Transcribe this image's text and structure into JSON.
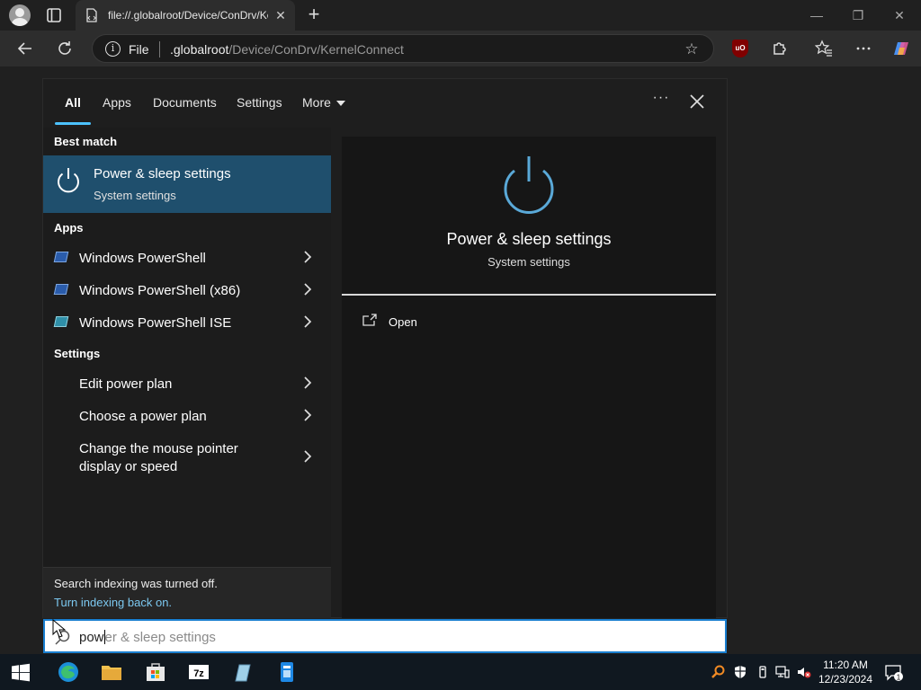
{
  "browser": {
    "tab_title": "file://.globalroot/Device/ConDrv/KernelConnect",
    "tab_close": "✕",
    "new_tab": "+",
    "win_minimize": "—",
    "win_restore": "❐",
    "win_close": "✕",
    "address": {
      "scheme_label": "File",
      "host": ".globalroot",
      "path": "/Device/ConDrv/KernelConnect"
    },
    "extension_label": "uO"
  },
  "search": {
    "tabs": [
      {
        "label": "All"
      },
      {
        "label": "Apps"
      },
      {
        "label": "Documents"
      },
      {
        "label": "Settings"
      },
      {
        "label": "More"
      }
    ],
    "more_dots": "···",
    "best_match": {
      "heading": "Best match",
      "title": "Power & sleep settings",
      "subtitle": "System settings"
    },
    "apps": {
      "heading": "Apps",
      "items": [
        {
          "label": "Windows PowerShell"
        },
        {
          "label": "Windows PowerShell (x86)"
        },
        {
          "label": "Windows PowerShell ISE"
        }
      ]
    },
    "settings": {
      "heading": "Settings",
      "items": [
        {
          "label": "Edit power plan"
        },
        {
          "label": "Choose a power plan"
        },
        {
          "label_line1": "Change the mouse pointer",
          "label_line2": "display or speed"
        }
      ]
    },
    "indexing": {
      "message": "Search indexing was turned off.",
      "link": "Turn indexing back on."
    },
    "preview": {
      "title": "Power & sleep settings",
      "subtitle": "System settings",
      "open_label": "Open"
    },
    "query": {
      "typed": "pow",
      "suggestion": "er & sleep settings"
    }
  },
  "taskbar": {
    "time": "11:20 AM",
    "date": "12/23/2024",
    "notification_count": "1",
    "apps": [
      "start-icon",
      "edge-icon",
      "file-explorer-icon",
      "store-icon",
      "7zip-icon",
      "notepad-icon",
      "app-icon"
    ]
  },
  "colors": {
    "accent": "#4cc2ff",
    "best_match_bg": "#1f4f6d",
    "link": "#7cc8f0"
  }
}
